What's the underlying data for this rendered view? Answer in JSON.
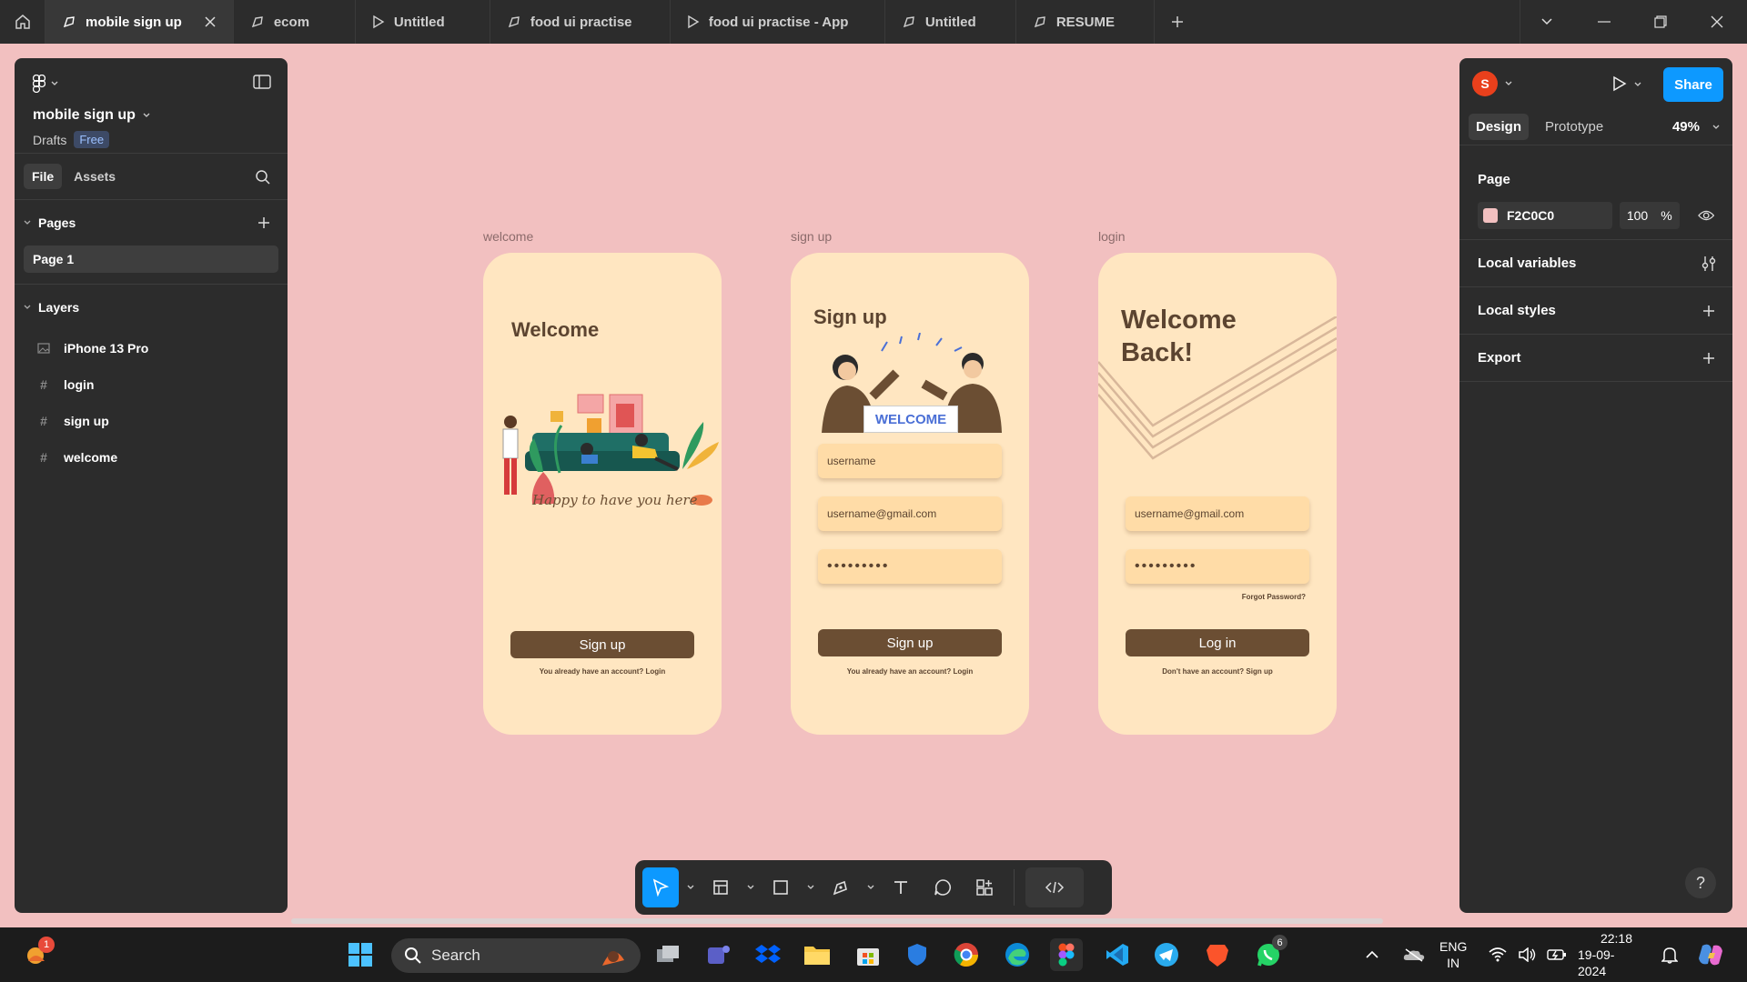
{
  "tabs": [
    {
      "label": "mobile sign up",
      "icon": "design-file-icon",
      "active": true
    },
    {
      "label": "ecom",
      "icon": "design-file-icon"
    },
    {
      "label": "Untitled",
      "icon": "prototype-play-icon"
    },
    {
      "label": "food ui practise",
      "icon": "design-file-icon"
    },
    {
      "label": "food ui practise - App",
      "icon": "prototype-play-icon"
    },
    {
      "label": "Untitled",
      "icon": "design-file-icon"
    },
    {
      "label": "RESUME",
      "icon": "design-file-icon"
    }
  ],
  "left_panel": {
    "project_title": "mobile sign up",
    "drafts": "Drafts",
    "plan_badge": "Free",
    "tab_file": "File",
    "tab_assets": "Assets",
    "pages_header": "Pages",
    "pages": [
      "Page 1"
    ],
    "layers_header": "Layers",
    "layers": [
      {
        "name": "iPhone 13 Pro",
        "icon": "image-icon"
      },
      {
        "name": "login",
        "icon": "frame-icon"
      },
      {
        "name": "sign up",
        "icon": "frame-icon"
      },
      {
        "name": "welcome",
        "icon": "frame-icon"
      }
    ]
  },
  "right_panel": {
    "avatar_letter": "S",
    "share_label": "Share",
    "tab_design": "Design",
    "tab_prototype": "Prototype",
    "zoom": "49%",
    "page_header": "Page",
    "page_fill_hex": "F2C0C0",
    "page_fill_opacity": "100",
    "percent": "%",
    "local_variables": "Local variables",
    "local_styles": "Local styles",
    "export": "Export",
    "help": "?"
  },
  "canvas": {
    "background": "#f2c0c0",
    "frames": {
      "welcome": {
        "label": "welcome",
        "title": "Welcome",
        "caption": "Happy to have you here",
        "button": "Sign up",
        "footer": "You already have an account? Login"
      },
      "signup": {
        "label": "sign up",
        "title": "Sign up",
        "banner": "WELCOME",
        "username_placeholder": "username",
        "email_placeholder": "username@gmail.com",
        "password_mask": "•••••••••",
        "button": "Sign up",
        "footer": "You already have an account? Login"
      },
      "login": {
        "label": "login",
        "title_line1": "Welcome",
        "title_line2": "Back!",
        "email_placeholder": "username@gmail.com",
        "password_mask": "•••••••••",
        "forgot": "Forgot Password?",
        "button": "Log in",
        "footer": "Don't have an account? Sign up"
      }
    }
  },
  "toolbar": {
    "tools": [
      "move-tool",
      "frame-tool",
      "shape-tool",
      "pen-tool",
      "text-tool",
      "comment-tool",
      "resources-tool",
      "dev-mode-toggle"
    ]
  },
  "taskbar": {
    "search_placeholder": "Search",
    "weather_badge": "1",
    "whatsapp_badge": "6",
    "lang_line1": "ENG",
    "lang_line2": "IN",
    "time": "22:18",
    "date": "19-09-2024"
  },
  "colors": {
    "accent": "#0d99ff",
    "phone_bg": "#ffe6c1",
    "input_bg": "#ffdca7",
    "button_brown": "#6b4e33",
    "text_brown": "#5c4430"
  }
}
